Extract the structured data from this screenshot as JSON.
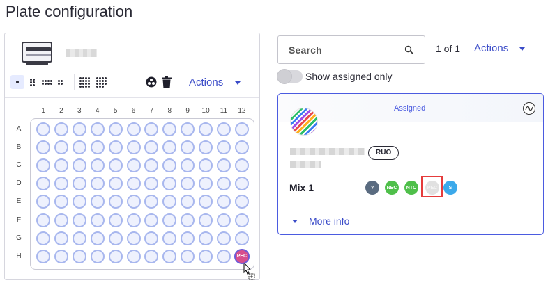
{
  "page": {
    "title": "Plate configuration"
  },
  "left_panel": {
    "toolbar": {
      "actions_label": "Actions"
    },
    "plate": {
      "columns": [
        "1",
        "2",
        "3",
        "4",
        "5",
        "6",
        "7",
        "8",
        "9",
        "10",
        "11",
        "12"
      ],
      "rows": [
        "A",
        "B",
        "C",
        "D",
        "E",
        "F",
        "G",
        "H"
      ],
      "assigned_well": {
        "row": "H",
        "column": "12",
        "label": "PEC"
      }
    }
  },
  "right_panel": {
    "search": {
      "placeholder": "Search"
    },
    "pager": "1 of 1",
    "actions_label": "Actions",
    "toggle": {
      "label": "Show assigned only",
      "on": false
    },
    "card": {
      "status": "Assigned",
      "badge": "RUO",
      "mix_label": "Mix 1",
      "chips": [
        {
          "label": "?",
          "color": "#5a6b80"
        },
        {
          "label": "NEC",
          "color": "#4fbf4a"
        },
        {
          "label": "NTC",
          "color": "#4fbf4a"
        },
        {
          "label": "PEC",
          "color": "#e1e1e1",
          "selected": true
        },
        {
          "label": "S",
          "color": "#3ca9ea"
        }
      ],
      "more_info": "More info"
    }
  },
  "colors": {
    "accent": "#3b4cc8",
    "well_border": "#a8b7ee",
    "pec_well": "#d74f8e",
    "highlight": "#e53c3c"
  }
}
